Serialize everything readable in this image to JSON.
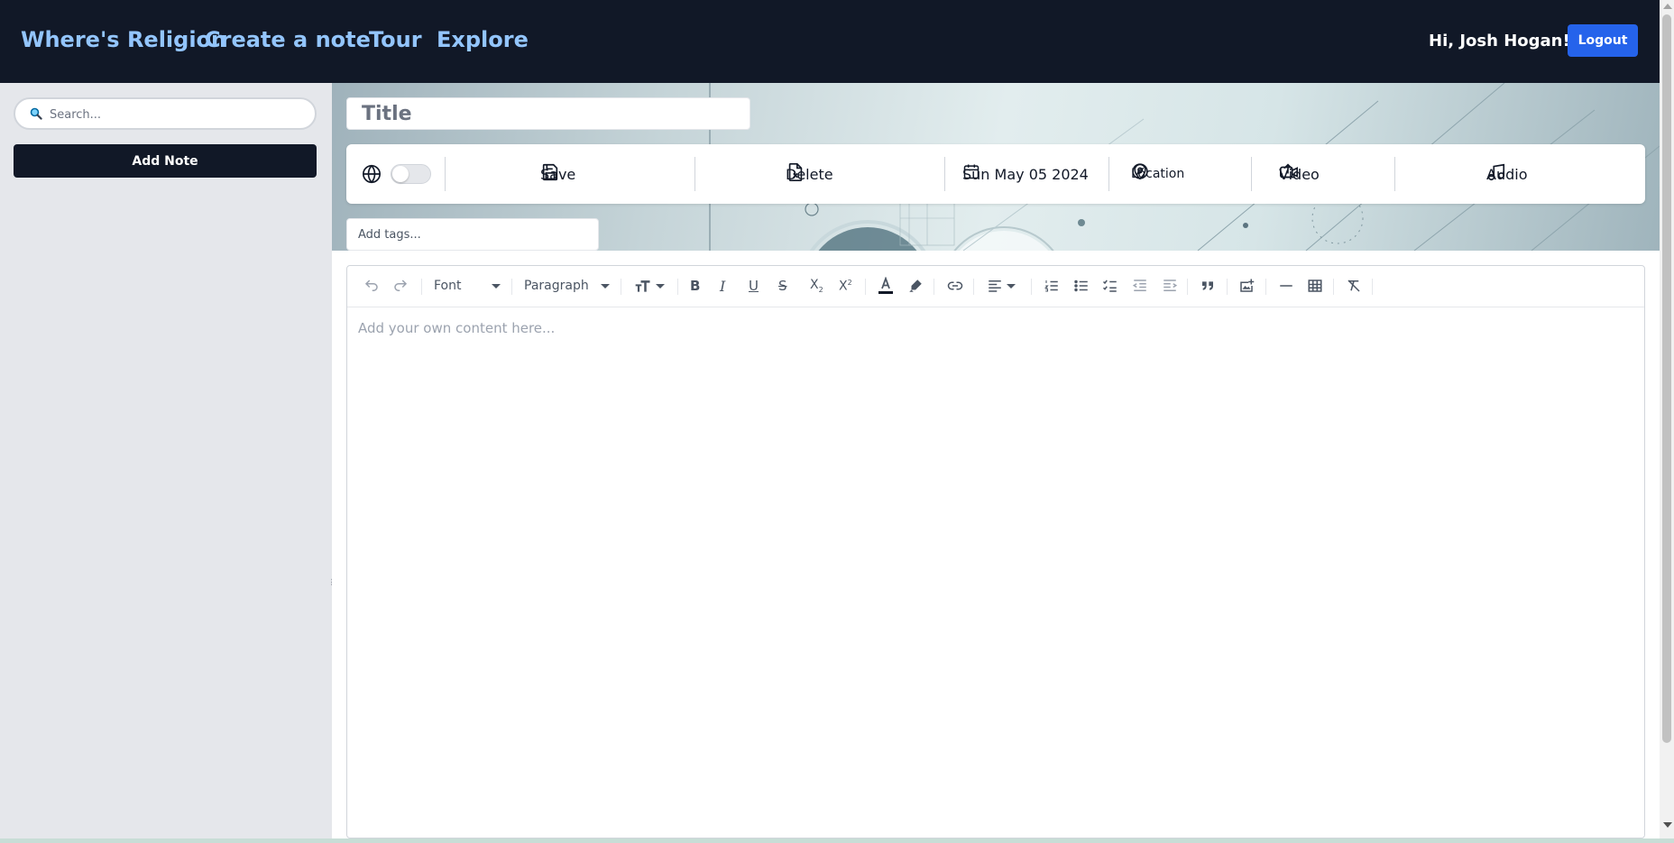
{
  "header": {
    "brand": "Where's Religion",
    "nav": {
      "create": "Create a note",
      "tour": "Tour",
      "explore": "Explore"
    },
    "greeting": "Hi, Josh Hogan!",
    "logout_label": "Logout"
  },
  "sidebar": {
    "search_placeholder": "Search...",
    "search_icon": "magnifier-icon",
    "add_note_label": "Add Note"
  },
  "note": {
    "title_placeholder": "Title",
    "tags_placeholder": "Add tags...",
    "toolbar": {
      "save": "Save",
      "delete": "Delete",
      "date": "Sun May 05 2024",
      "location": "Location",
      "video": "Video",
      "audio": "Audio"
    }
  },
  "editor": {
    "font_select": "Font",
    "block_select": "Paragraph",
    "placeholder": "Add your own content here..."
  },
  "colors": {
    "header_bg": "#111827",
    "nav_link": "#93c5fd",
    "logout_bg": "#2563eb",
    "add_note_bg": "#111827",
    "sidebar_bg": "#e5e7eb"
  }
}
